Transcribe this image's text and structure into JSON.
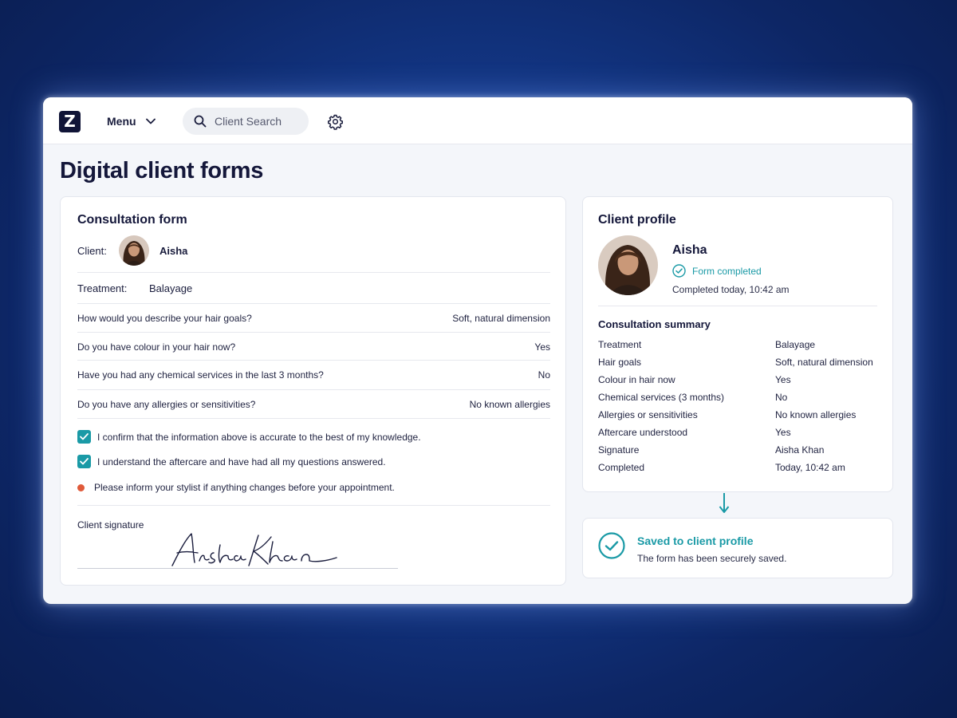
{
  "header": {
    "logo": "Z",
    "menu_label": "Menu",
    "search_placeholder": "Client Search"
  },
  "page_title": "Digital client forms",
  "consultation_form": {
    "title": "Consultation form",
    "client_label": "Client:",
    "client_name": "Aisha",
    "treatment_label": "Treatment:",
    "treatment_value": "Balayage",
    "questions": [
      {
        "q": "How would you describe your hair goals?",
        "a": "Soft, natural dimension"
      },
      {
        "q": "Do you have colour in your hair now?",
        "a": "Yes"
      },
      {
        "q": "Have you had any chemical services in the last 3 months?",
        "a": "No"
      },
      {
        "q": "Do you have any allergies or sensitivities?",
        "a": "No known allergies"
      }
    ],
    "confirmations": [
      {
        "text": "I confirm that the information above is accurate to the best of my knowledge.",
        "checked": true
      },
      {
        "text": "I understand the aftercare and have had all my questions answered.",
        "checked": true
      }
    ],
    "note": "Please inform your stylist if anything changes before your appointment.",
    "signature_label": "Client signature",
    "signature": "Aisha Khan"
  },
  "client_profile": {
    "title": "Client profile",
    "name": "Aisha",
    "status": "Form completed",
    "completed_time": "Completed today, 10:42 am",
    "summary_title": "Consultation summary",
    "summary": [
      {
        "k": "Treatment",
        "v": "Balayage"
      },
      {
        "k": "Hair goals",
        "v": "Soft, natural dimension"
      },
      {
        "k": "Colour in hair now",
        "v": "Yes"
      },
      {
        "k": "Chemical services (3 months)",
        "v": "No"
      },
      {
        "k": "Allergies or sensitivities",
        "v": "No known allergies"
      },
      {
        "k": "Aftercare understood",
        "v": "Yes"
      },
      {
        "k": "Signature",
        "v": "Aisha Khan"
      },
      {
        "k": "Completed",
        "v": "Today, 10:42 am"
      }
    ]
  },
  "saved": {
    "title": "Saved to client profile",
    "subtitle": "The form has been securely saved."
  },
  "colors": {
    "accent": "#1a9aa6",
    "brand": "#101437",
    "note_dot": "#e05a3a"
  }
}
